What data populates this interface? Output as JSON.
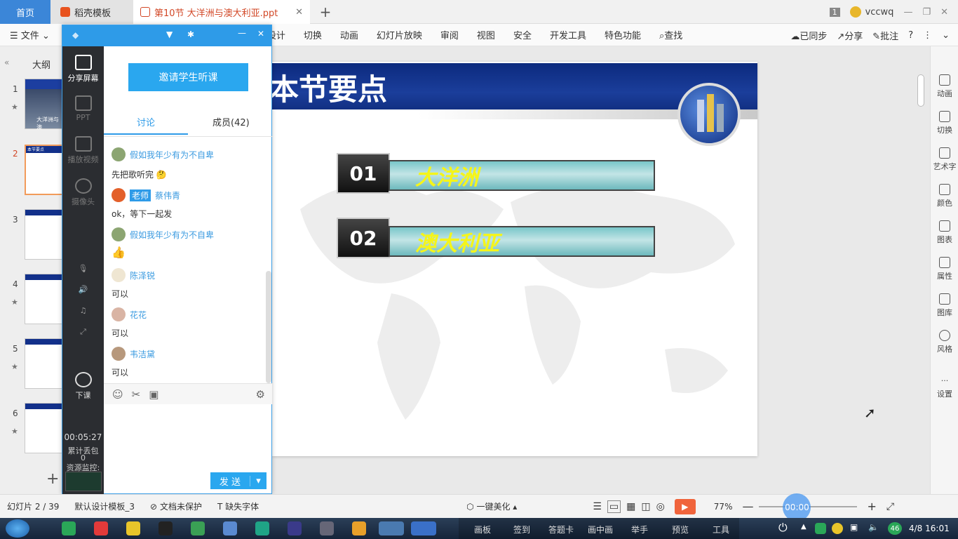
{
  "tabs": {
    "home": "首页",
    "docer": "稻壳模板",
    "file": "第10节 大洋洲与澳大利亚.ppt",
    "add": "+"
  },
  "user": {
    "badge": "1",
    "name": "vccwq"
  },
  "menu": {
    "file": "文件",
    "items": [
      "设计",
      "切换",
      "动画",
      "幻灯片放映",
      "审阅",
      "视图",
      "安全",
      "开发工具",
      "特色功能"
    ],
    "search": "查找",
    "sync": "已同步",
    "share": "分享",
    "comment": "批注",
    "help": "?"
  },
  "outline": {
    "label": "大纲"
  },
  "thumbs": [
    "1",
    "2",
    "3",
    "4",
    "5",
    "6"
  ],
  "thumb_text": {
    "t1": "大洋洲与澳",
    "t2": "本节要点"
  },
  "chat": {
    "invite": "邀请学生听课",
    "tab_discuss": "讨论",
    "tab_members": "成员(42)",
    "side": {
      "share": "分享屏幕",
      "ppt": "PPT",
      "video": "播放视频",
      "camera": "摄像头",
      "end": "下课",
      "timer": "00:05:27",
      "lost_label": "累计丢包",
      "lost_value": "0",
      "monitor": "资源监控:"
    },
    "messages": [
      {
        "name": "假如我年少有为不自卑",
        "text": "先把歌听完"
      },
      {
        "tag": "老师",
        "name": "蔡伟青",
        "text": "ok，等下一起发"
      },
      {
        "name": "假如我年少有为不自卑",
        "text": "👍"
      },
      {
        "name": "陈泽锐",
        "text": "可以"
      },
      {
        "name": "花花",
        "text": "可以"
      },
      {
        "name": "韦洁黛",
        "text": "可以"
      }
    ],
    "send": "发 送"
  },
  "slide": {
    "title": "本节要点",
    "items": [
      {
        "num": "01",
        "label": "大洋洲"
      },
      {
        "num": "02",
        "label": "澳大利亚"
      }
    ]
  },
  "rightpane": [
    "动画",
    "切换",
    "艺术字",
    "颜色",
    "图表",
    "属性",
    "图库",
    "风格",
    "设置"
  ],
  "status": {
    "slide": "幻灯片 2 / 39",
    "template": "默认设计模板_3",
    "protect": "文档未保护",
    "font": "缺失字体",
    "beautify": "一键美化",
    "zoom": "77%",
    "timer": "00:00"
  },
  "taskbar": {
    "items": [
      "画板",
      "签到",
      "答题卡",
      "画中画",
      "举手",
      "预览",
      "工具"
    ],
    "badge": "46",
    "datetime": "4/8 16:01"
  },
  "colors": {
    "accent": "#2e9be8",
    "banner": "#12308a",
    "title_yellow": "#f5f519"
  }
}
